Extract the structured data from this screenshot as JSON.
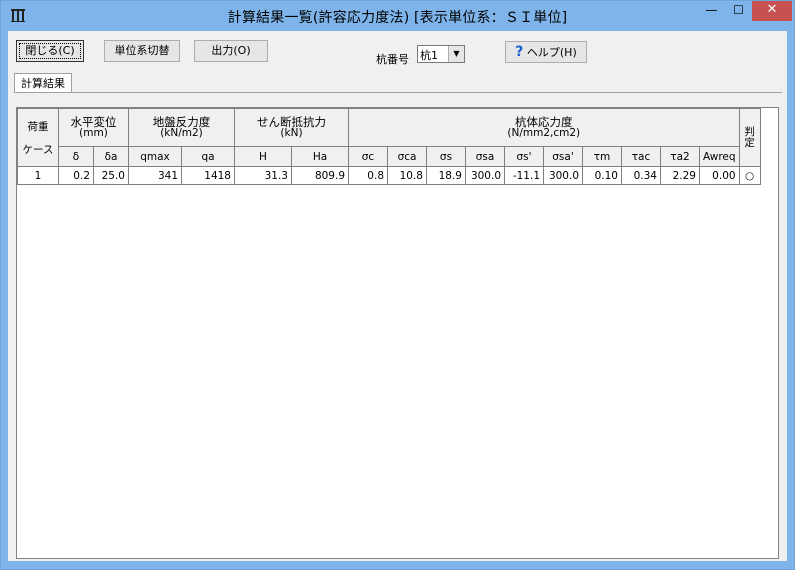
{
  "window": {
    "title": "計算結果一覧(許容応力度法) [表示単位系：ＳＩ単位]",
    "minimize": "—",
    "maximize": "☐",
    "close": "✕"
  },
  "toolbar": {
    "close_label": "閉じる(C)",
    "units_label": "単位系切替",
    "output_label": "出力(O)",
    "pile_label": "杭番号",
    "pile_value": "杭1",
    "help_icon": "?",
    "help_label": "ヘルプ(H)"
  },
  "tab": {
    "label": "計算結果"
  },
  "table": {
    "groups": {
      "load": [
        "荷重",
        "ケース"
      ],
      "disp": [
        "水平変位",
        "(mm)"
      ],
      "ground": [
        "地盤反力度",
        "(kN/m2)"
      ],
      "shear": [
        "せん断抵抗力",
        "(kN)"
      ],
      "stress": [
        "杭体応力度",
        "(N/mm2,cm2)"
      ],
      "judge": [
        "判",
        "定"
      ]
    },
    "columns": [
      "δ",
      "δa",
      "qmax",
      "qa",
      "H",
      "Ha",
      "σc",
      "σca",
      "σs",
      "σsa",
      "σs'",
      "σsa'",
      "τm",
      "τac",
      "τa2",
      "Awreq"
    ],
    "rows": [
      [
        "1",
        "0.2",
        "25.0",
        "341",
        "1418",
        "31.3",
        "809.9",
        "0.8",
        "10.8",
        "18.9",
        "300.0",
        "-11.1",
        "300.0",
        "0.10",
        "0.34",
        "2.29",
        "0.00",
        "○"
      ]
    ]
  }
}
